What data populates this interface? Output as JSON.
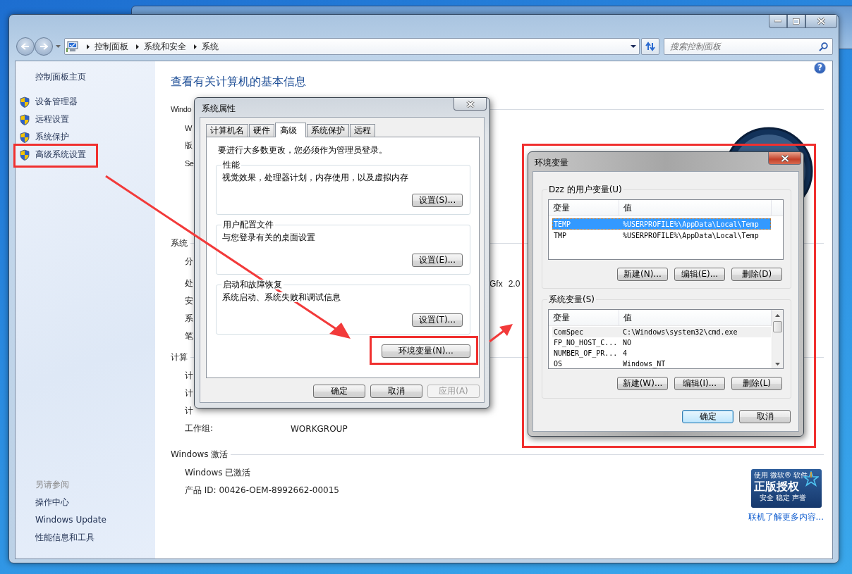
{
  "main_window": {
    "address_bar": {
      "breadcrumbs": [
        "控制面板",
        "系统和安全",
        "系统"
      ],
      "search": {
        "placeholder": "搜索控制面板"
      }
    },
    "sidebar": {
      "home": "控制面板主页",
      "tasks": [
        {
          "label": "设备管理器",
          "highlighted": false
        },
        {
          "label": "远程设置",
          "highlighted": false
        },
        {
          "label": "系统保护",
          "highlighted": false
        },
        {
          "label": "高级系统设置",
          "highlighted": true
        }
      ],
      "see_also_title": "另请参阅",
      "see_also": [
        "操作中心",
        "Windows Update",
        "性能信息和工具"
      ]
    },
    "content": {
      "heading": "查看有关计算机的基本信息",
      "help": "?",
      "sections": [
        {
          "title": "Windo",
          "rows": [
            {
              "label": "W"
            },
            {
              "label": "版"
            },
            {
              "label": "Se"
            }
          ]
        },
        {
          "title": "系统",
          "rows": [
            {
              "label": "分"
            },
            {
              "label": "处",
              "tail": [
                "Gfx",
                "2.0"
              ]
            },
            {
              "label": "安"
            },
            {
              "label": "系"
            },
            {
              "label": "笔"
            }
          ]
        },
        {
          "title": "计算",
          "rows": [
            {
              "label": "计"
            },
            {
              "label": "计"
            },
            {
              "label": "计"
            },
            {
              "label": "工作组:",
              "value": "WORKGROUP"
            }
          ]
        },
        {
          "title": "Windows 激活",
          "rows": [
            {
              "label": "Windows 已激活"
            },
            {
              "label": "产品 ID: 00426-OEM-8992662-00015"
            }
          ]
        }
      ],
      "badge": {
        "top": [
          "使用",
          "微软®",
          "软件"
        ],
        "main": "正版授权",
        "sub": "安全 稳定 声誉"
      },
      "link": "联机了解更多内容..."
    }
  },
  "system_properties": {
    "title": "系统属性",
    "tabs": [
      {
        "label": "计算机名",
        "selected": false
      },
      {
        "label": "硬件",
        "selected": false
      },
      {
        "label": "高级",
        "selected": true
      },
      {
        "label": "系统保护",
        "selected": false
      },
      {
        "label": "远程",
        "selected": false
      }
    ],
    "notice": "要进行大多数更改，您必须作为管理员登录。",
    "groups": [
      {
        "title": "性能",
        "description": "视觉效果，处理器计划，内存使用，以及虚拟内存",
        "button": "设置(S)..."
      },
      {
        "title": "用户配置文件",
        "description": "与您登录有关的桌面设置",
        "button": "设置(E)..."
      },
      {
        "title": "启动和故障恢复",
        "description": "系统启动、系统失败和调试信息",
        "button": "设置(T)..."
      }
    ],
    "env_button": {
      "label": "环境变量(N)...",
      "highlighted": true
    },
    "buttons": [
      {
        "label": "确定",
        "disabled": false
      },
      {
        "label": "取消",
        "disabled": false
      },
      {
        "label": "应用(A)",
        "disabled": true
      }
    ]
  },
  "env_dialog": {
    "title": "环境变量",
    "highlighted": true,
    "groups": [
      {
        "title": "Dzz 的用户变量(U)",
        "columns": [
          "变量",
          "值"
        ],
        "scrollbar": false,
        "rows": [
          {
            "cells": [
              "TEMP",
              "%USERPROFILE%\\AppData\\Local\\Temp"
            ],
            "selected": true,
            "hovered": false
          },
          {
            "cells": [
              "TMP",
              "%USERPROFILE%\\AppData\\Local\\Temp"
            ],
            "selected": false,
            "hovered": false
          }
        ],
        "buttons": [
          "新建(N)...",
          "编辑(E)...",
          "删除(D)"
        ]
      },
      {
        "title": "系统变量(S)",
        "columns": [
          "变量",
          "值"
        ],
        "scrollbar": true,
        "rows": [
          {
            "cells": [
              "ComSpec",
              "C:\\Windows\\system32\\cmd.exe"
            ],
            "selected": false,
            "hovered": true
          },
          {
            "cells": [
              "FP_NO_HOST_C...",
              "NO"
            ],
            "selected": false,
            "hovered": false
          },
          {
            "cells": [
              "NUMBER_OF_PR...",
              "4"
            ],
            "selected": false,
            "hovered": false
          },
          {
            "cells": [
              "OS",
              "Windows_NT"
            ],
            "selected": false,
            "hovered": false
          }
        ],
        "buttons": [
          "新建(W)...",
          "编辑(I)...",
          "删除(L)"
        ]
      }
    ],
    "buttons": [
      {
        "label": "确定",
        "default": true
      },
      {
        "label": "取消",
        "default": false
      }
    ]
  }
}
